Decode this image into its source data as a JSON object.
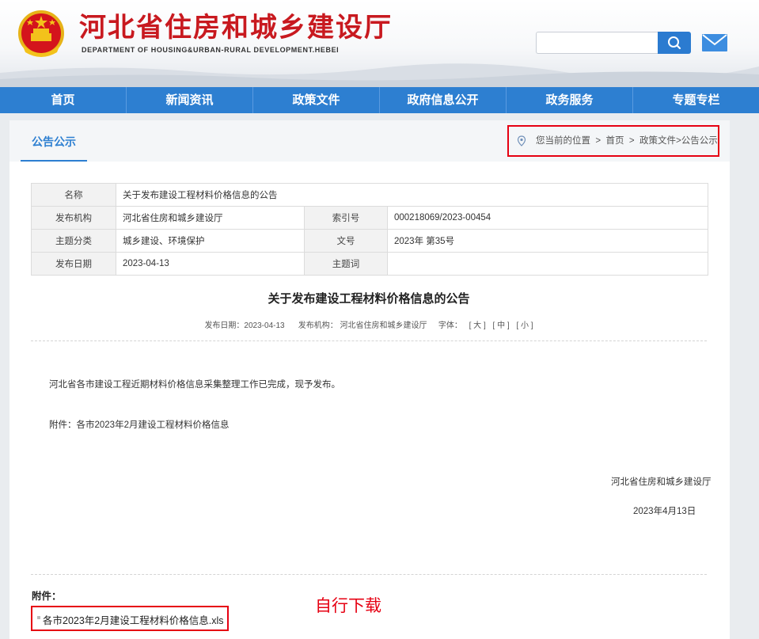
{
  "header": {
    "title": "河北省住房和城乡建设厅",
    "subtitle": "DEPARTMENT OF HOUSING&URBAN-RURAL DEVELOPMENT.HEBEI",
    "search_value": "",
    "icons": {
      "emblem": "national-emblem-icon",
      "search": "search-icon",
      "mail": "mail-icon"
    }
  },
  "nav": [
    "首页",
    "新闻资讯",
    "政策文件",
    "政府信息公开",
    "政务服务",
    "专题专栏"
  ],
  "tab": {
    "active_label": "公告公示"
  },
  "breadcrumb": {
    "prefix": "您当前的位置",
    "sep": ">",
    "home": "首页",
    "path": "政策文件>公告公示"
  },
  "meta": {
    "name_key": "名称",
    "name_val": "关于发布建设工程材料价格信息的公告",
    "org_key": "发布机构",
    "org_val": "河北省住房和城乡建设厅",
    "index_key": "索引号",
    "index_val": "000218069/2023-00454",
    "topic_key": "主题分类",
    "topic_val": "城乡建设、环境保护",
    "docno_key": "文号",
    "docno_val": "2023年 第35号",
    "date_key": "发布日期",
    "date_val": "2023-04-13",
    "subject_key": "主题词",
    "subject_val": ""
  },
  "article": {
    "title": "关于发布建设工程材料价格信息的公告",
    "info_date": "发布日期：2023-04-13",
    "info_org": "发布机构： 河北省住房和城乡建设厅",
    "info_font": "字体：",
    "font_large": "[ 大 ]",
    "font_medium": "[ 中 ]",
    "font_small": "[ 小 ]",
    "para1": "河北省各市建设工程近期材料价格信息采集整理工作已完成，现予发布。",
    "para2": "附件：各市2023年2月建设工程材料价格信息",
    "sign_org": "河北省住房和城乡建设厅",
    "sign_date": "2023年4月13日"
  },
  "attachment": {
    "label": "附件：",
    "file": "各市2023年2月建设工程材料价格信息.xls"
  },
  "annotation": "自行下载",
  "colors": {
    "brand_red": "#c8191f",
    "nav_blue": "#2d7fd1",
    "highlight_red": "#e60012"
  }
}
